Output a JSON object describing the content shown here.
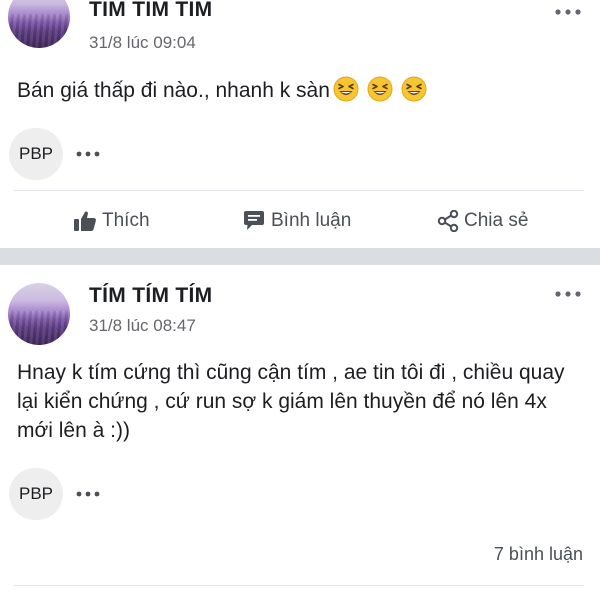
{
  "posts": [
    {
      "author": "TÍM TÍM TÍM",
      "time": "31/8 lúc 09:04",
      "text": "Bán giá thấp đi nào., nhanh k sàn",
      "emoji": [
        "grinning-squinting-face",
        "grinning-squinting-face",
        "grinning-squinting-face"
      ],
      "tag": "PBP"
    },
    {
      "author": "TÍM TÍM TÍM",
      "time": "31/8 lúc 08:47",
      "text": "Hnay k tím cứng thì cũng cận tím , ae tin tôi đi , chiều quay lại kiển chứng , cứ run sợ k giám lên thuyền để nó lên 4x mới lên à :))",
      "tag": "PBP",
      "comment_count": "7 bình luận"
    }
  ],
  "actions": {
    "like": "Thích",
    "comment": "Bình luận",
    "share": "Chia sẻ"
  },
  "colors": {
    "text": "#1c1e21",
    "secondary": "#65676b",
    "separator": "#dadde1",
    "pill": "#eeeeef"
  }
}
